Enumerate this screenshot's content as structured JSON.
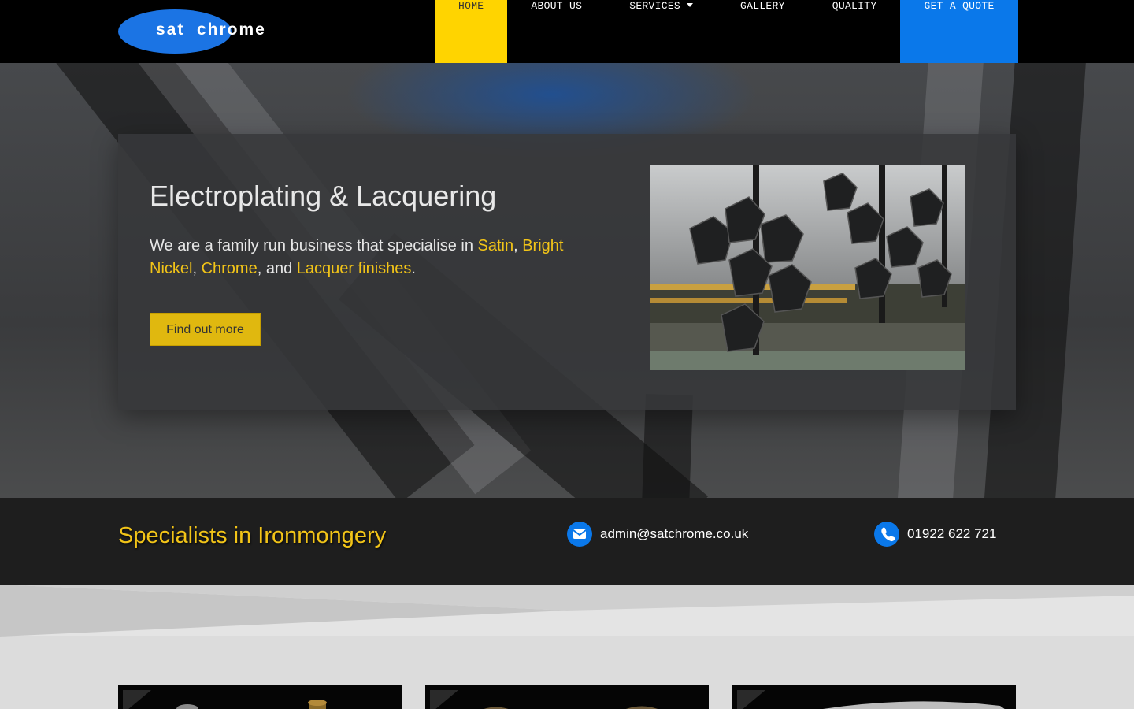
{
  "brand": {
    "logo_part1": "sat",
    "logo_part2": "chrome",
    "logo_color": "#1b74e4"
  },
  "nav": {
    "items": [
      {
        "label": "HOME",
        "active": true
      },
      {
        "label": "ABOUT US"
      },
      {
        "label": "SERVICES",
        "has_dropdown": true
      },
      {
        "label": "GALLERY"
      },
      {
        "label": "QUALITY"
      },
      {
        "label": "GET A QUOTE",
        "cta": true
      }
    ],
    "active_color": "#ffd400",
    "cta_color": "#0a78ea"
  },
  "hero": {
    "title": "Electroplating & Lacquering",
    "text_parts": [
      {
        "text": "We are a family run business that specialise in ",
        "highlight": false
      },
      {
        "text": "Satin",
        "highlight": true
      },
      {
        "text": ", ",
        "highlight": false
      },
      {
        "text": "Bright Nickel",
        "highlight": true
      },
      {
        "text": ", ",
        "highlight": false
      },
      {
        "text": "Chrome",
        "highlight": true
      },
      {
        "text": ", and ",
        "highlight": false
      },
      {
        "text": "Lacquer finishes",
        "highlight": true
      },
      {
        "text": ".",
        "highlight": false
      }
    ],
    "button_label": "Find out more",
    "highlight_color": "#f2c418"
  },
  "infobar": {
    "tagline": "Specialists in Ironmongery",
    "email": "admin@satchrome.co.uk",
    "phone": "01922 622 721",
    "email_icon": "envelope-icon",
    "phone_icon": "phone-icon"
  },
  "products": {
    "tiles": [
      {
        "id": "tile-1"
      },
      {
        "id": "tile-2"
      },
      {
        "id": "tile-3"
      }
    ]
  }
}
